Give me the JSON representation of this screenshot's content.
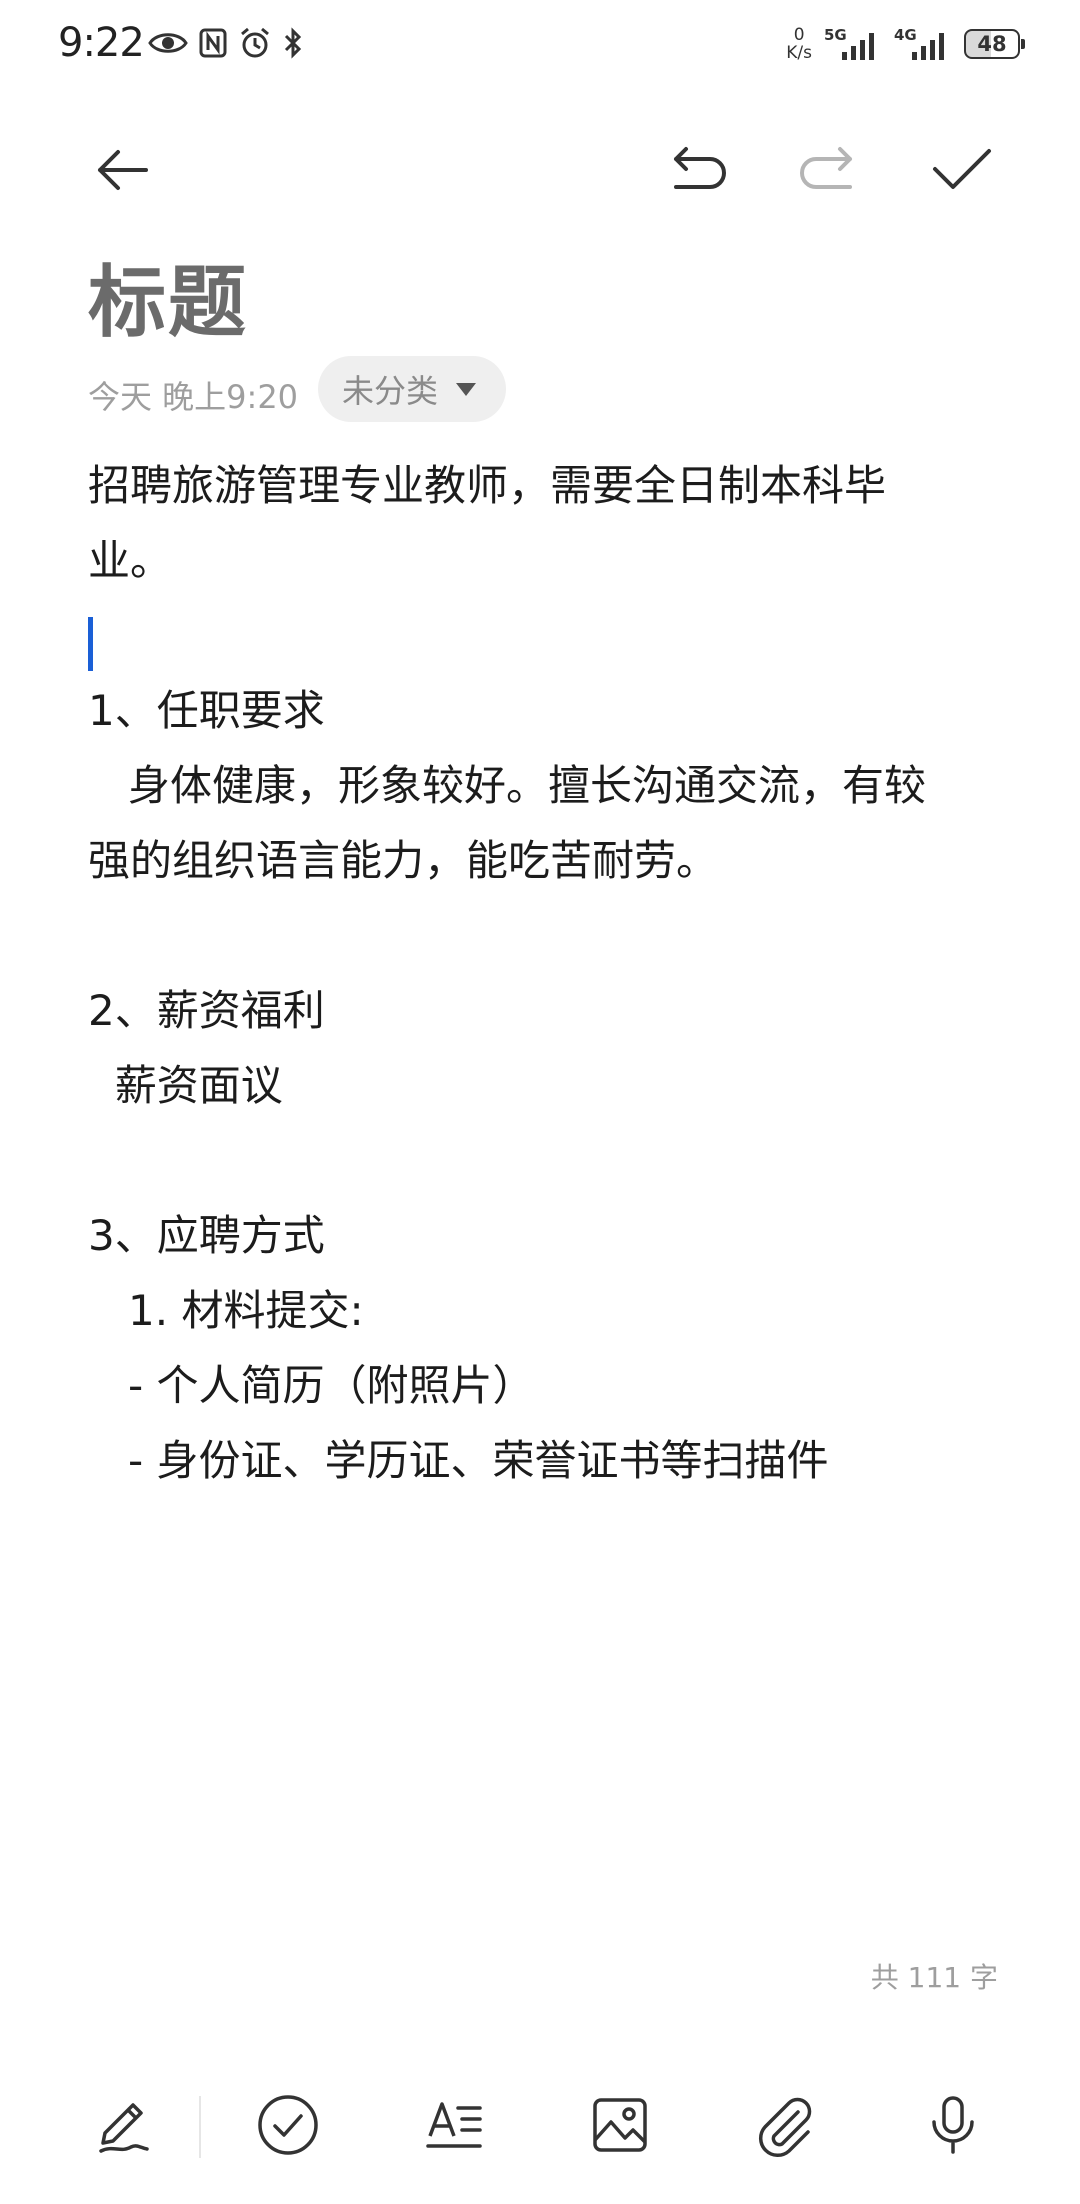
{
  "status_bar": {
    "time": "9:22",
    "net_speed_value": "0",
    "net_speed_unit": "K/s",
    "sim1_tag": "5G",
    "sim2_tag": "4G",
    "battery": "48"
  },
  "toolbar": {
    "back_icon": "arrow-left-icon",
    "undo_icon": "undo-icon",
    "redo_icon": "redo-icon",
    "done_icon": "checkmark-icon"
  },
  "note": {
    "title": "标题",
    "date": "今天 晚上9:20",
    "category": "未分类",
    "lines": [
      "招聘旅游管理专业教师，需要全日制本科毕",
      "业。",
      "",
      "1、任职要求",
      "   身体健康，形象较好。擅长沟通交流，有较",
      "强的组织语言能力，能吃苦耐劳。",
      "",
      "2、薪资福利",
      "  薪资面议",
      "",
      "3、应聘方式",
      "   1. 材料提交:",
      "   - 个人简历（附照片）",
      "   - 身份证、学历证、荣誉证书等扫描件"
    ],
    "word_count": "共 111 字"
  },
  "bottom_bar": {
    "items": [
      "handwriting-pen-icon",
      "checklist-icon",
      "text-format-icon",
      "image-icon",
      "attachment-icon",
      "microphone-icon"
    ]
  },
  "colors": {
    "title": "#6b6b6b",
    "meta": "#9e9e9e",
    "chip_bg": "#efefef",
    "caret": "#1a5fd6",
    "icon": "#333333",
    "redo_disabled": "#b5b5b5"
  }
}
